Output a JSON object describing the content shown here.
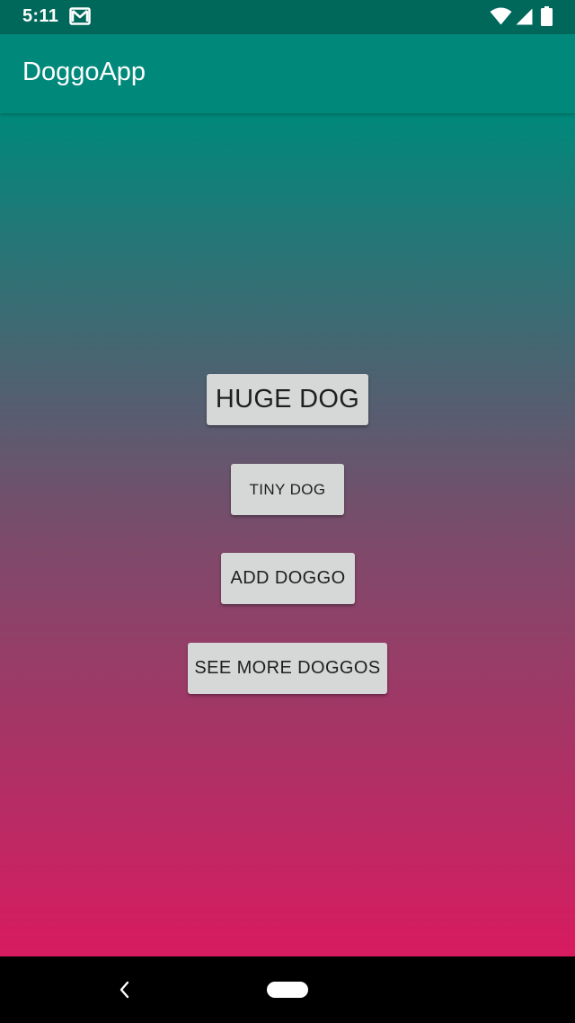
{
  "status_bar": {
    "time": "5:11",
    "notification_icon": "gmail-icon",
    "wifi_icon": "wifi-icon",
    "signal_icon": "cell-signal-icon",
    "battery_icon": "battery-icon"
  },
  "app_bar": {
    "title": "DoggoApp",
    "color": "#00897b"
  },
  "content": {
    "gradient_top": "#00897b",
    "gradient_bottom": "#d81b60"
  },
  "buttons": {
    "huge_dog": "HUGE DOG",
    "tiny_dog": "TINY DOG",
    "add_doggo": "ADD DOGGO",
    "see_more": "SEE MORE DOGGOS"
  },
  "nav_bar": {
    "back_icon": "back-icon",
    "home_icon": "home-pill-icon"
  }
}
